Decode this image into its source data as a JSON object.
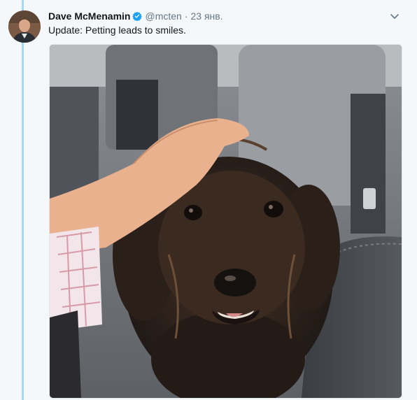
{
  "tweet": {
    "author_name": "Dave McMenamin",
    "handle": "@mcten",
    "separator": "·",
    "date": "23 янв.",
    "text": "Update: Petting leads to smiles.",
    "verified": true
  },
  "icons": {
    "verified": "verified-badge-icon",
    "caret": "chevron-down-icon"
  },
  "colors": {
    "thread_line": "#a6d7f5",
    "verified_blue": "#1da1f2",
    "muted_text": "#657786",
    "background": "#f5f8fa"
  }
}
